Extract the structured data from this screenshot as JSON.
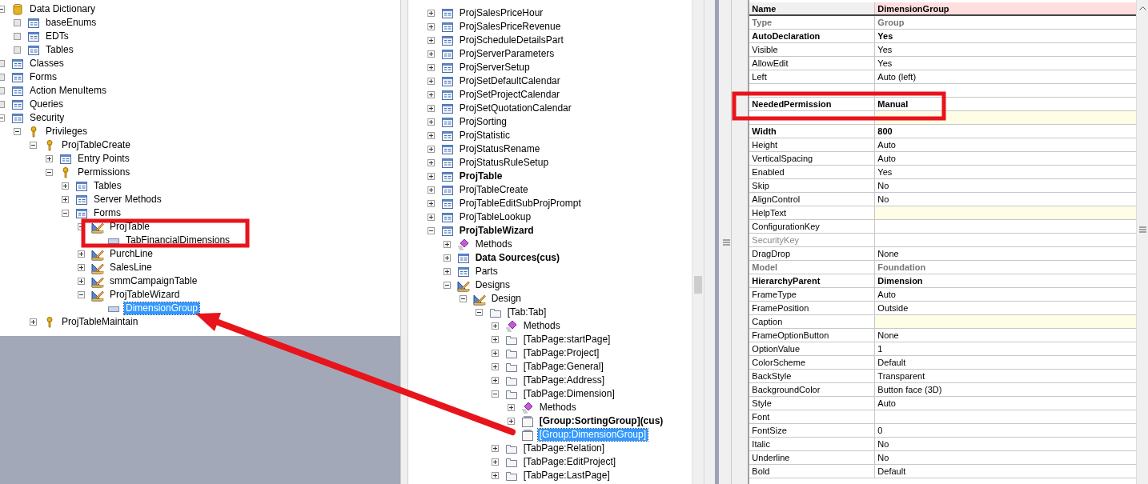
{
  "aot_tree": {
    "nodes": [
      {
        "label": "Data Dictionary",
        "kind": "database",
        "expanded": true,
        "empty": false,
        "selected": false,
        "children": [
          {
            "label": "baseEnums",
            "kind": "module",
            "empty": true,
            "selected": false
          },
          {
            "label": "EDTs",
            "kind": "module",
            "empty": true,
            "selected": false
          },
          {
            "label": "Tables",
            "kind": "module",
            "empty": true,
            "selected": false
          }
        ]
      },
      {
        "label": "Classes",
        "kind": "module",
        "empty": true,
        "selected": false
      },
      {
        "label": "Forms",
        "kind": "module",
        "empty": true,
        "selected": false
      },
      {
        "label": "Action MenuItems",
        "kind": "module",
        "empty": true,
        "selected": false
      },
      {
        "label": "Queries",
        "kind": "module",
        "empty": true,
        "selected": false
      },
      {
        "label": "Security",
        "kind": "module",
        "expanded": true,
        "empty": false,
        "selected": false,
        "children": [
          {
            "label": "Privileges",
            "kind": "key",
            "expanded": true,
            "empty": false,
            "selected": false,
            "children": [
              {
                "label": "ProjTableCreate",
                "kind": "key",
                "expanded": true,
                "empty": false,
                "selected": false,
                "children": [
                  {
                    "label": "Entry Points",
                    "kind": "module",
                    "expanded": false,
                    "empty": false,
                    "selected": false
                  },
                  {
                    "label": "Permissions",
                    "kind": "key",
                    "expanded": true,
                    "empty": false,
                    "selected": false,
                    "children": [
                      {
                        "label": "Tables",
                        "kind": "module",
                        "expanded": false,
                        "empty": false,
                        "selected": false
                      },
                      {
                        "label": "Server Methods",
                        "kind": "module",
                        "expanded": false,
                        "empty": false,
                        "selected": false
                      },
                      {
                        "label": "Forms",
                        "kind": "module",
                        "expanded": true,
                        "empty": false,
                        "selected": false,
                        "children": [
                          {
                            "label": "ProjTable",
                            "kind": "design",
                            "expanded": true,
                            "empty": false,
                            "selected": false,
                            "children": [
                              {
                                "label": "TabFinancialDimensions",
                                "kind": "control",
                                "selected": false
                              }
                            ]
                          },
                          {
                            "label": "PurchLine",
                            "kind": "design",
                            "expanded": false,
                            "empty": false,
                            "selected": false
                          },
                          {
                            "label": "SalesLine",
                            "kind": "design",
                            "expanded": false,
                            "empty": false,
                            "selected": false
                          },
                          {
                            "label": "smmCampaignTable",
                            "kind": "design",
                            "expanded": false,
                            "empty": false,
                            "selected": false
                          },
                          {
                            "label": "ProjTableWizard",
                            "kind": "design",
                            "expanded": true,
                            "empty": false,
                            "selected": false,
                            "children": [
                              {
                                "label": "DimensionGroup",
                                "kind": "control",
                                "selected": true
                              }
                            ]
                          }
                        ]
                      }
                    ]
                  }
                ]
              },
              {
                "label": "ProjTableMaintain",
                "kind": "key",
                "expanded": false,
                "empty": false,
                "selected": false
              }
            ]
          }
        ]
      }
    ]
  },
  "forms_tree": {
    "nodes": [
      {
        "label": "ProjSalesPriceHour",
        "kind": "module",
        "expanded": false,
        "bold": false,
        "selected": false
      },
      {
        "label": "ProjSalesPriceRevenue",
        "kind": "module",
        "expanded": false,
        "bold": false,
        "selected": false
      },
      {
        "label": "ProjScheduleDetailsPart",
        "kind": "module",
        "expanded": false,
        "bold": false,
        "selected": false
      },
      {
        "label": "ProjServerParameters",
        "kind": "module",
        "expanded": false,
        "bold": false,
        "selected": false
      },
      {
        "label": "ProjServerSetup",
        "kind": "module",
        "expanded": false,
        "bold": false,
        "selected": false
      },
      {
        "label": "ProjSetDefaultCalendar",
        "kind": "module",
        "expanded": false,
        "bold": false,
        "selected": false
      },
      {
        "label": "ProjSetProjectCalendar",
        "kind": "module",
        "expanded": false,
        "bold": false,
        "selected": false
      },
      {
        "label": "ProjSetQuotationCalendar",
        "kind": "module",
        "expanded": false,
        "bold": false,
        "selected": false
      },
      {
        "label": "ProjSorting",
        "kind": "module",
        "expanded": false,
        "bold": false,
        "selected": false
      },
      {
        "label": "ProjStatistic",
        "kind": "module",
        "expanded": false,
        "bold": false,
        "selected": false
      },
      {
        "label": "ProjStatusRename",
        "kind": "module",
        "expanded": false,
        "bold": false,
        "selected": false
      },
      {
        "label": "ProjStatusRuleSetup",
        "kind": "module",
        "expanded": false,
        "bold": false,
        "selected": false
      },
      {
        "label": "ProjTable",
        "kind": "module",
        "expanded": false,
        "bold": true,
        "selected": false
      },
      {
        "label": "ProjTableCreate",
        "kind": "module",
        "expanded": false,
        "bold": false,
        "selected": false
      },
      {
        "label": "ProjTableEditSubProjPrompt",
        "kind": "module",
        "expanded": false,
        "bold": false,
        "selected": false
      },
      {
        "label": "ProjTableLookup",
        "kind": "module",
        "expanded": false,
        "bold": false,
        "selected": false
      },
      {
        "label": "ProjTableWizard",
        "kind": "module",
        "expanded": true,
        "bold": true,
        "selected": false,
        "children": [
          {
            "label": "Methods",
            "kind": "methods",
            "expanded": false,
            "bold": false,
            "selected": false
          },
          {
            "label": "Data Sources(cus)",
            "kind": "module",
            "expanded": false,
            "bold": true,
            "selected": false
          },
          {
            "label": "Parts",
            "kind": "module",
            "expanded": false,
            "bold": false,
            "selected": false
          },
          {
            "label": "Designs",
            "kind": "design",
            "expanded": true,
            "bold": false,
            "selected": false,
            "children": [
              {
                "label": "Design",
                "kind": "design",
                "expanded": true,
                "bold": false,
                "selected": false,
                "children": [
                  {
                    "label": "[Tab:Tab]",
                    "kind": "folder",
                    "expanded": true,
                    "bold": false,
                    "selected": false,
                    "children": [
                      {
                        "label": "Methods",
                        "kind": "methods",
                        "expanded": false,
                        "bold": false,
                        "selected": false
                      },
                      {
                        "label": "[TabPage:startPage]",
                        "kind": "folder",
                        "expanded": false,
                        "bold": false,
                        "selected": false
                      },
                      {
                        "label": "[TabPage:Project]",
                        "kind": "folder",
                        "expanded": false,
                        "bold": false,
                        "selected": false
                      },
                      {
                        "label": "[TabPage:General]",
                        "kind": "folder",
                        "expanded": false,
                        "bold": false,
                        "selected": false
                      },
                      {
                        "label": "[TabPage:Address]",
                        "kind": "folder",
                        "expanded": false,
                        "bold": false,
                        "selected": false
                      },
                      {
                        "label": "[TabPage:Dimension]",
                        "kind": "folder",
                        "expanded": true,
                        "bold": false,
                        "selected": false,
                        "children": [
                          {
                            "label": "Methods",
                            "kind": "methods",
                            "expanded": false,
                            "bold": false,
                            "selected": false
                          },
                          {
                            "label": "[Group:SortingGroup](cus)",
                            "kind": "group",
                            "expanded": false,
                            "bold": true,
                            "selected": false
                          },
                          {
                            "label": "[Group:DimensionGroup]",
                            "kind": "group",
                            "bold": false,
                            "selected": true
                          }
                        ]
                      },
                      {
                        "label": "[TabPage:Relation]",
                        "kind": "folder",
                        "expanded": false,
                        "bold": false,
                        "selected": false
                      },
                      {
                        "label": "[TabPage:EditProject]",
                        "kind": "folder",
                        "expanded": false,
                        "bold": false,
                        "selected": false
                      },
                      {
                        "label": "[TabPage:LastPage]",
                        "kind": "folder",
                        "expanded": false,
                        "bold": false,
                        "selected": false
                      }
                    ]
                  }
                ]
              }
            ]
          }
        ]
      }
    ]
  },
  "properties": [
    {
      "name": "Name",
      "value": "DimensionGroup",
      "kind": "key",
      "tinted": false
    },
    {
      "name": "Type",
      "value": "Group",
      "kind": "inherited",
      "tinted": false
    },
    {
      "name": "AutoDeclaration",
      "value": "Yes",
      "kind": "bold",
      "tinted": false
    },
    {
      "name": "Visible",
      "value": "Yes",
      "kind": "normal",
      "tinted": false
    },
    {
      "name": "AllowEdit",
      "value": "Yes",
      "kind": "normal",
      "tinted": false
    },
    {
      "name": "Left",
      "value": "Auto (left)",
      "kind": "normal",
      "tinted": false
    },
    {
      "kind": "normal",
      "tinted": false
    },
    {
      "name": "NeededPermission",
      "value": "Manual",
      "kind": "bold",
      "tinted": false
    },
    {
      "kind": "normal",
      "tinted": true
    },
    {
      "name": "Width",
      "value": "800",
      "kind": "bold",
      "tinted": false
    },
    {
      "name": "Height",
      "value": "Auto",
      "kind": "normal",
      "tinted": false
    },
    {
      "name": "VerticalSpacing",
      "value": "Auto",
      "kind": "normal",
      "tinted": false
    },
    {
      "name": "Enabled",
      "value": "Yes",
      "kind": "normal",
      "tinted": false
    },
    {
      "name": "Skip",
      "value": "No",
      "kind": "normal",
      "tinted": false
    },
    {
      "name": "AlignControl",
      "value": "No",
      "kind": "normal",
      "tinted": false
    },
    {
      "name": "HelpText",
      "kind": "normal",
      "tinted": true
    },
    {
      "name": "ConfigurationKey",
      "kind": "normal",
      "tinted": false
    },
    {
      "name": "SecurityKey",
      "kind": "disabled",
      "tinted": false
    },
    {
      "name": "DragDrop",
      "value": "None",
      "kind": "normal",
      "tinted": false
    },
    {
      "name": "Model",
      "value": "Foundation",
      "kind": "inherited",
      "tinted": false
    },
    {
      "name": "HierarchyParent",
      "value": "Dimension",
      "kind": "bold",
      "tinted": false
    },
    {
      "name": "FrameType",
      "value": "Auto",
      "kind": "normal",
      "tinted": false
    },
    {
      "name": "FramePosition",
      "value": "Outside",
      "kind": "normal",
      "tinted": false
    },
    {
      "name": "Caption",
      "kind": "normal",
      "tinted": true
    },
    {
      "name": "FrameOptionButton",
      "value": "None",
      "kind": "normal",
      "tinted": false
    },
    {
      "name": "OptionValue",
      "value": "1",
      "kind": "normal",
      "tinted": false
    },
    {
      "name": "ColorScheme",
      "value": "Default",
      "kind": "normal",
      "tinted": false
    },
    {
      "name": "BackStyle",
      "value": "Transparent",
      "kind": "normal",
      "tinted": false
    },
    {
      "name": "BackgroundColor",
      "value": "Button face (3D)",
      "kind": "normal",
      "tinted": false
    },
    {
      "name": "Style",
      "value": "Auto",
      "kind": "normal",
      "tinted": false
    },
    {
      "name": "Font",
      "kind": "normal",
      "tinted": false
    },
    {
      "name": "FontSize",
      "value": "0",
      "kind": "normal",
      "tinted": false
    },
    {
      "name": "Italic",
      "value": "No",
      "kind": "normal",
      "tinted": false
    },
    {
      "name": "Underline",
      "value": "No",
      "kind": "normal",
      "tinted": false
    },
    {
      "name": "Bold",
      "value": "Default",
      "kind": "normal",
      "tinted": false
    }
  ]
}
